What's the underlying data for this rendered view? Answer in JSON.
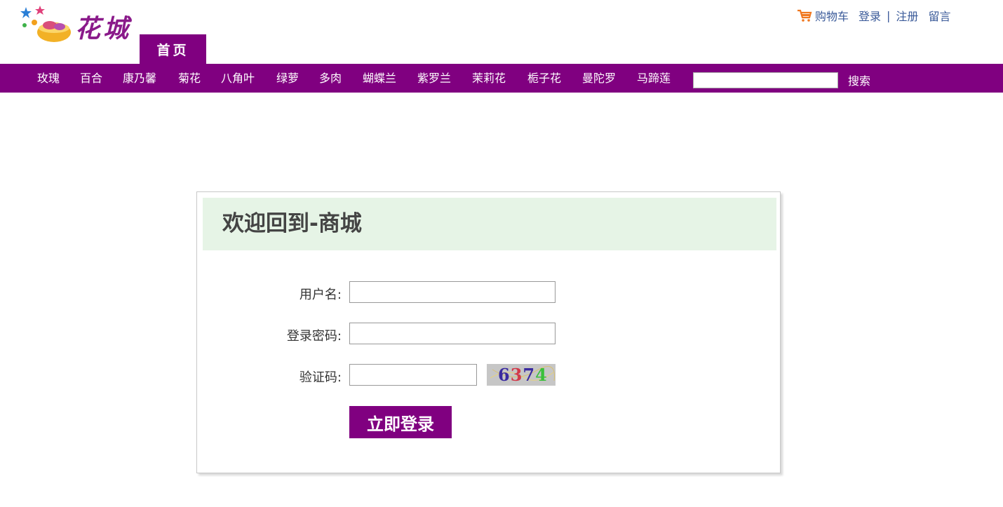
{
  "header": {
    "logo_text": "花城",
    "home_tab": "首页"
  },
  "toplinks": {
    "cart": "购物车",
    "login": "登录",
    "separator": "|",
    "register": "注册",
    "message": "留言"
  },
  "nav": {
    "items": [
      "玫瑰",
      "百合",
      "康乃馨",
      "菊花",
      "八角叶",
      "绿萝",
      "多肉",
      "蝴蝶兰",
      "紫罗兰",
      "茉莉花",
      "栀子花",
      "曼陀罗",
      "马蹄莲"
    ],
    "search_value": "",
    "search_button": "搜索"
  },
  "login_panel": {
    "title": "欢迎回到-商城",
    "username_label": "用户名:",
    "username_value": "",
    "password_label": "登录密码:",
    "password_value": "",
    "captcha_label": "验证码:",
    "captcha_value": "",
    "captcha_image_text": "6374",
    "submit_button": "立即登录"
  },
  "colors": {
    "brand": "#800080",
    "panel_header_bg": "#e6f4e6",
    "link": "#3a5a99"
  }
}
